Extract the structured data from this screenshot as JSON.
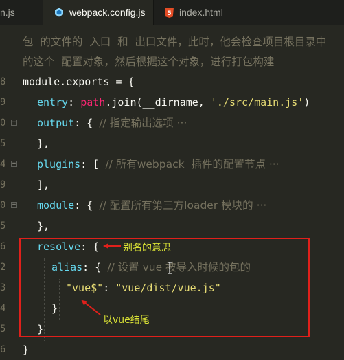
{
  "tabs": [
    {
      "label": "n.js"
    },
    {
      "label": "webpack.config.js"
    },
    {
      "label": "index.html"
    }
  ],
  "icon_labels": {
    "html5": "5"
  },
  "comment_lines": [
    "包  的文件的  入口  和  出口文件，此时，他会检查项目根目录中",
    "的这个  配置对象，然后根据这个对象，进行打包构建"
  ],
  "lines": [
    {
      "num": "8",
      "key": "module.exports",
      "rest": " = {"
    },
    {
      "num": "9",
      "key": "entry",
      "rest": ": ",
      "fn": "path",
      "rest2": ".join(__dirname, ",
      "str": "'./src/main.js'",
      "rest3": ")"
    },
    {
      "num": "0",
      "key": "output",
      "rest": ": { ",
      "cm": "// 指定输出选项 ···"
    },
    {
      "num": "5",
      "rest": "},"
    },
    {
      "num": "4",
      "key": "plugins",
      "rest": ": [ ",
      "cm": "// 所有webpack  插件的配置节点 ···"
    },
    {
      "num": "9",
      "rest": "],"
    },
    {
      "num": "0",
      "key": "module",
      "rest": ": { ",
      "cm": "// 配置所有第三方loader 模块的 ···"
    },
    {
      "num": "5",
      "rest": "},"
    },
    {
      "num": "6",
      "key": "resolve",
      "rest": ": {"
    },
    {
      "num": "2",
      "key": "alias",
      "rest": ": { ",
      "cm": "// 设置 vue 被导入时候的包的"
    },
    {
      "num": "3",
      "str": "\"vue$\"",
      "rest": ": ",
      "str2": "\"vue/dist/vue.js\""
    },
    {
      "num": "4",
      "rest": "}"
    },
    {
      "num": "5",
      "rest": "}"
    },
    {
      "num": "6",
      "rest": "}"
    }
  ],
  "annotations": {
    "alias_meaning": "别名的意思",
    "ends_with_vue": "以vue结尾"
  },
  "colors": {
    "background": "#272822",
    "keyword": "#66d9ef",
    "function": "#f92672",
    "string": "#e6db74",
    "comment": "#75715e",
    "highlight_box": "#e0201b",
    "annotation_text": "#d8e035"
  }
}
